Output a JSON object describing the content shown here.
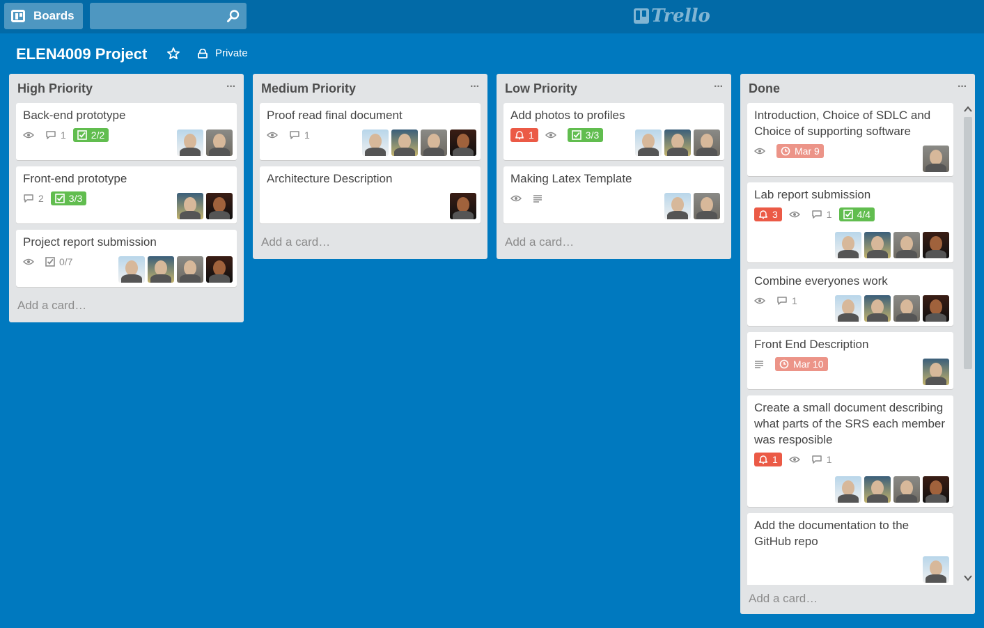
{
  "header": {
    "boards_label": "Boards",
    "search_placeholder": "",
    "logo_text": "Trello"
  },
  "board": {
    "title": "ELEN4009 Project",
    "visibility": "Private"
  },
  "lists": [
    {
      "title": "High Priority",
      "menu": "···",
      "add_card": "Add a card…",
      "cards": [
        {
          "title": "Back-end prototype",
          "comments": "1",
          "checklist": "2/2"
        },
        {
          "title": "Front-end prototype",
          "comments": "2",
          "checklist": "3/3"
        },
        {
          "title": "Project report submission",
          "checklist": "0/7"
        }
      ]
    },
    {
      "title": "Medium Priority",
      "menu": "···",
      "add_card": "Add a card…",
      "cards": [
        {
          "title": "Proof read final document",
          "comments": "1"
        },
        {
          "title": "Architecture Description"
        }
      ]
    },
    {
      "title": "Low Priority",
      "menu": "···",
      "add_card": "Add a card…",
      "cards": [
        {
          "title": "Add photos to profiles",
          "notifications": "1",
          "checklist": "3/3"
        },
        {
          "title": "Making Latex Template"
        }
      ]
    },
    {
      "title": "Done",
      "menu": "···",
      "add_card": "Add a card…",
      "cards": [
        {
          "title": "Introduction, Choice of SDLC and Choice of supporting software",
          "due": "Mar 9"
        },
        {
          "title": "Lab report submission",
          "notifications": "3",
          "comments": "1",
          "checklist": "4/4"
        },
        {
          "title": "Combine everyones work",
          "comments": "1"
        },
        {
          "title": "Front End Description",
          "due": "Mar 10"
        },
        {
          "title": "Create a small document describing what parts of the SRS each member was resposible",
          "notifications": "1",
          "comments": "1"
        },
        {
          "title": "Add the documentation to the GitHub repo"
        }
      ]
    }
  ],
  "colors": {
    "board_bg": "#0079bf",
    "header_bg": "#026aa7",
    "list_bg": "#e2e4e6",
    "green_badge": "#61bd4f",
    "red_badge": "#eb5a46",
    "due_badge": "#ec9488"
  }
}
